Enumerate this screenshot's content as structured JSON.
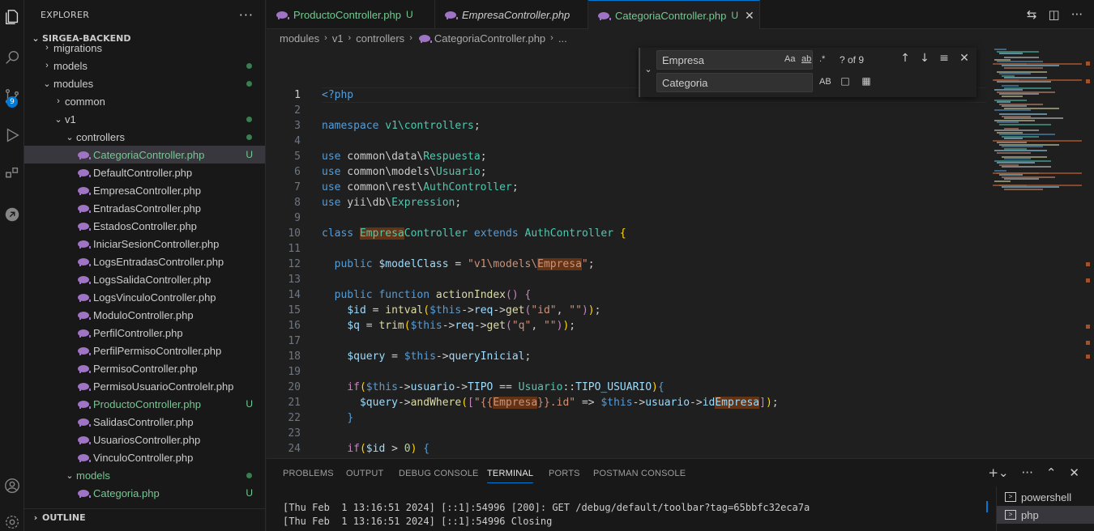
{
  "sidebar": {
    "title": "EXPLORER",
    "more": "···",
    "project": "SIRGEA-BACKEND",
    "outline": "OUTLINE",
    "tree": [
      {
        "label": "migrations",
        "kind": "folder",
        "open": false,
        "indent": 1,
        "dot": false
      },
      {
        "label": "models",
        "kind": "folder",
        "open": false,
        "indent": 1,
        "dot": true
      },
      {
        "label": "modules",
        "kind": "folder",
        "open": true,
        "indent": 1,
        "dot": true
      },
      {
        "label": "common",
        "kind": "folder",
        "open": false,
        "indent": 2,
        "dot": false
      },
      {
        "label": "v1",
        "kind": "folder",
        "open": true,
        "indent": 2,
        "dot": true
      },
      {
        "label": "controllers",
        "kind": "folder",
        "open": true,
        "indent": 3,
        "dot": true
      },
      {
        "label": "CategoriaController.php",
        "kind": "php",
        "indent": 4,
        "badge": "U",
        "green": true,
        "selected": true
      },
      {
        "label": "DefaultController.php",
        "kind": "php",
        "indent": 4
      },
      {
        "label": "EmpresaController.php",
        "kind": "php",
        "indent": 4
      },
      {
        "label": "EntradasController.php",
        "kind": "php",
        "indent": 4
      },
      {
        "label": "EstadosController.php",
        "kind": "php",
        "indent": 4
      },
      {
        "label": "IniciarSesionController.php",
        "kind": "php",
        "indent": 4
      },
      {
        "label": "LogsEntradasController.php",
        "kind": "php",
        "indent": 4
      },
      {
        "label": "LogsSalidaController.php",
        "kind": "php",
        "indent": 4
      },
      {
        "label": "LogsVinculoController.php",
        "kind": "php",
        "indent": 4
      },
      {
        "label": "ModuloController.php",
        "kind": "php",
        "indent": 4
      },
      {
        "label": "PerfilController.php",
        "kind": "php",
        "indent": 4
      },
      {
        "label": "PerfilPermisoController.php",
        "kind": "php",
        "indent": 4
      },
      {
        "label": "PermisoController.php",
        "kind": "php",
        "indent": 4
      },
      {
        "label": "PermisoUsuarioControlelr.php",
        "kind": "php",
        "indent": 4
      },
      {
        "label": "ProductoController.php",
        "kind": "php",
        "indent": 4,
        "badge": "U",
        "green": true
      },
      {
        "label": "SalidasController.php",
        "kind": "php",
        "indent": 4
      },
      {
        "label": "UsuariosController.php",
        "kind": "php",
        "indent": 4
      },
      {
        "label": "VinculoController.php",
        "kind": "php",
        "indent": 4
      },
      {
        "label": "models",
        "kind": "folder",
        "open": true,
        "indent": 3,
        "dot": true,
        "green": true
      },
      {
        "label": "Categoria.php",
        "kind": "php",
        "indent": 4,
        "badge": "U",
        "green": true
      }
    ]
  },
  "tabs": [
    {
      "label": "ProductoController.php",
      "badge": "U",
      "green": true,
      "italic": false,
      "active": false
    },
    {
      "label": "EmpresaController.php",
      "badge": "",
      "green": false,
      "italic": true,
      "active": false
    },
    {
      "label": "CategoriaController.php",
      "badge": "U",
      "green": true,
      "italic": false,
      "active": true
    }
  ],
  "breadcrumb": [
    "modules",
    "v1",
    "controllers",
    "CategoriaController.php",
    "..."
  ],
  "find": {
    "search_value": "Empresa",
    "replace_value": "Categoria",
    "match_case": "Aa",
    "whole_word": "ab",
    "regex": ".*",
    "count": "? of 9",
    "preserve_case": "AB"
  },
  "editor": {
    "line_numbers": [
      "1",
      "2",
      "3",
      "4",
      "5",
      "6",
      "7",
      "8",
      "9",
      "10",
      "11",
      "12",
      "13",
      "14",
      "15",
      "16",
      "17",
      "18",
      "19",
      "20",
      "21",
      "22",
      "23",
      "24"
    ]
  },
  "panel": {
    "tabs": [
      "PROBLEMS",
      "OUTPUT",
      "DEBUG CONSOLE",
      "TERMINAL",
      "PORTS",
      "POSTMAN CONSOLE"
    ],
    "active_tab": "TERMINAL",
    "terminal_lines": [
      "[Thu Feb  1 13:16:51 2024] [::1]:54996 [200]: GET /debug/default/toolbar?tag=65bbfc32eca7a",
      "[Thu Feb  1 13:16:51 2024] [::1]:54996 Closing"
    ],
    "terminals": [
      {
        "label": "powershell",
        "active": false
      },
      {
        "label": "php",
        "active": true
      }
    ]
  },
  "activity": {
    "scm_badge": "9"
  },
  "colors": {
    "accent": "#0078d4",
    "untracked": "#73c991",
    "match_highlight": "#623315"
  }
}
